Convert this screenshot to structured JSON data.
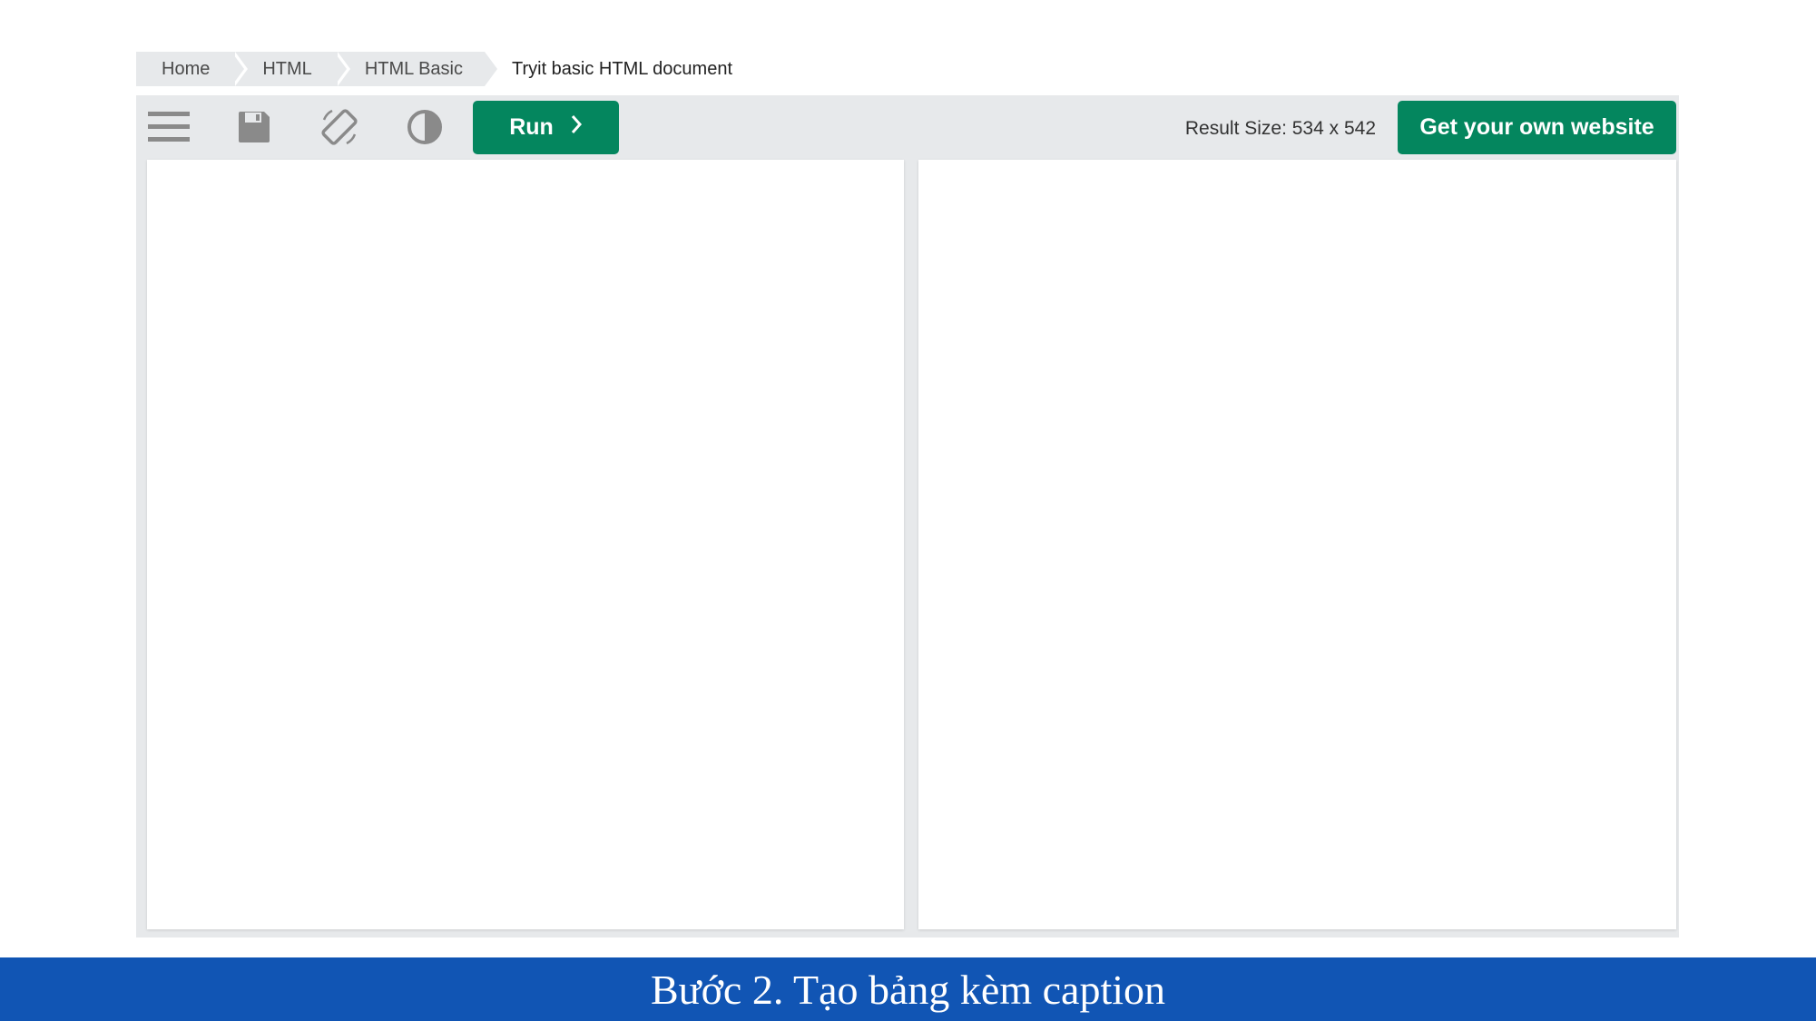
{
  "breadcrumb": {
    "items": [
      "Home",
      "HTML",
      "HTML Basic"
    ],
    "current": "Tryit basic HTML document"
  },
  "toolbar": {
    "icons": [
      "menu-icon",
      "save-icon",
      "rotate-icon",
      "contrast-icon"
    ],
    "run_label": "Run",
    "result_size": "Result Size: 534 x 542",
    "website_label": "Get your own website"
  },
  "caption": {
    "text": "Bước 2. Tạo bảng kèm caption"
  },
  "colors": {
    "accent": "#04865e",
    "toolbar_bg": "#e7e9eb",
    "caption_bg": "#1155b4",
    "icon": "#8a8a8a"
  }
}
